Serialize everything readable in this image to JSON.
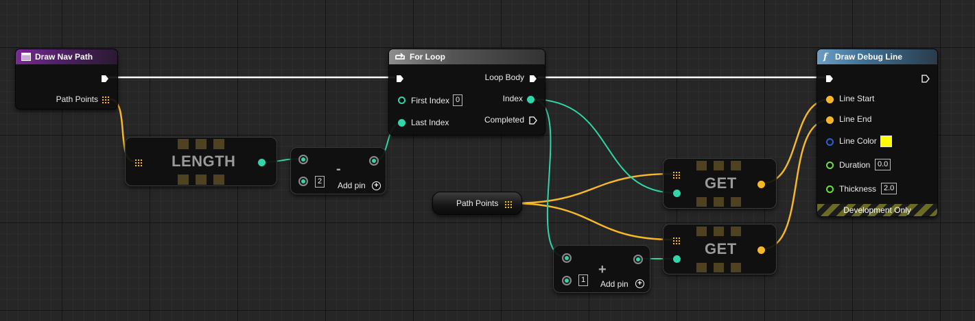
{
  "colors": {
    "exec_wire": "#ffffff",
    "int_wire": "#2fd6a9",
    "struct_wire": "#f5b82a",
    "color_pin": "#2a5fe0",
    "float_pin": "#6fdf3a",
    "swatch": "#ffff00"
  },
  "nodes": {
    "draw_nav_path": {
      "title": "Draw Nav Path",
      "icon": "event-window-icon",
      "pins": {
        "path_points": "Path Points"
      }
    },
    "length": {
      "title": "LENGTH"
    },
    "subtract": {
      "symbol": "-",
      "default_value": "2",
      "add_pin": "Add pin"
    },
    "for_loop": {
      "title": "For Loop",
      "icon": "loop-icon",
      "inputs": {
        "first_index": "First Index",
        "first_index_value": "0",
        "last_index": "Last Index"
      },
      "outputs": {
        "loop_body": "Loop Body",
        "index": "Index",
        "completed": "Completed"
      }
    },
    "path_points_var": {
      "label": "Path Points"
    },
    "get_1": {
      "title": "GET"
    },
    "get_2": {
      "title": "GET"
    },
    "add": {
      "symbol": "+",
      "default_value": "1",
      "add_pin": "Add pin"
    },
    "draw_debug_line": {
      "title": "Draw Debug Line",
      "icon": "function-icon",
      "inputs": {
        "line_start": "Line Start",
        "line_end": "Line End",
        "line_color": "Line Color",
        "duration": "Duration",
        "duration_value": "0.0",
        "thickness": "Thickness",
        "thickness_value": "2.0"
      },
      "footer": "Development Only"
    }
  }
}
